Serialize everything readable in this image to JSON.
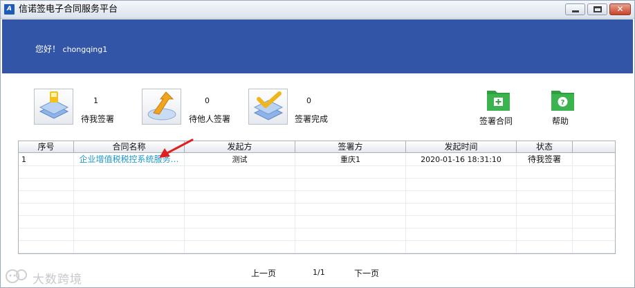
{
  "window": {
    "title": "信诺签电子合同服务平台",
    "logo_text": "A",
    "controls": {
      "minimize": "minimize",
      "maximize": "maximize",
      "close": "✕"
    }
  },
  "header": {
    "greeting": "您好！",
    "username": "chongqing1",
    "band_color": "#3355a8"
  },
  "toolbar": {
    "pending_me": {
      "count": "1",
      "label": "待我签署",
      "icon": "layers-icon"
    },
    "pending_others": {
      "count": "0",
      "label": "待他人签署",
      "icon": "arrow-up-layers-icon"
    },
    "completed": {
      "count": "0",
      "label": "签署完成",
      "icon": "check-layers-icon"
    },
    "sign_contract": {
      "label": "签署合同",
      "icon": "folder-plus-icon"
    },
    "help": {
      "label": "帮助",
      "icon": "folder-question-icon"
    },
    "folder_color": "#2e9e3f"
  },
  "table": {
    "columns": [
      "序号",
      "合同名称",
      "发起方",
      "签署方",
      "发起时间",
      "状态"
    ],
    "rows": [
      {
        "index": "1",
        "name": "企业增值税税控系统服务…",
        "initiator": "测试",
        "signer": "重庆1",
        "time": "2020-01-16 18:31:10",
        "status": "待我签署"
      }
    ],
    "link_color": "#1d98c9"
  },
  "annotation": {
    "arrow_color": "#e02020"
  },
  "pagination": {
    "prev": "上一页",
    "page": "1/1",
    "next": "下一页"
  },
  "watermark": {
    "text": "大数跨境"
  }
}
